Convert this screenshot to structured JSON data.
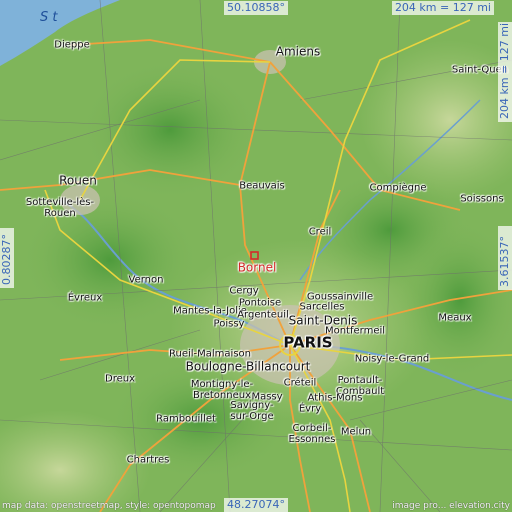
{
  "map": {
    "top_coordinate": "50.10858°",
    "bottom_coordinate": "48.27074°",
    "left_coordinate": "0.80287°",
    "right_coordinate": "3.61537°",
    "scale_horizontal": "204 km = 127 mi",
    "scale_vertical": "204 km = 127 mi",
    "sea_label": "S t",
    "credit_left": "map data: openstreetmap, style: opentopomap",
    "credit_right": "image pro... elevation.city"
  },
  "places": {
    "dieppe": "Dieppe",
    "amiens": "Amiens",
    "saint_quentin": "Saint-Quen",
    "rouen": "Rouen",
    "sotteville": "Sotteville-lès-Rouen",
    "beauvais": "Beauvais",
    "compiegne": "Compiègne",
    "soissons": "Soissons",
    "creil": "Creil",
    "bornel": "Bornel",
    "vernon": "Vernon",
    "evreux": "Évreux",
    "cergy": "Cergy",
    "pontoise": "Pontoise",
    "goussainville": "Goussainville",
    "sarcelles": "Sarcelles",
    "mantes": "Mantes-la-Jolie",
    "argenteuil": "Argenteuil",
    "saint_denis": "Saint-Denis",
    "poissy": "Poissy",
    "montfermeil": "Montfermeil",
    "meaux": "Meaux",
    "paris": "PARIS",
    "rueil": "Rueil-Malmaison",
    "noisy": "Noisy-le-Grand",
    "boulogne": "Boulogne-Billancourt",
    "dreux": "Dreux",
    "creteil": "Créteil",
    "pontault": "Pontault-Combault",
    "montigny": "Montigny-le-Bretonneux",
    "massy": "Massy",
    "athis": "Athis-Mons",
    "savigny": "Savigny-sur-Orge",
    "evry": "Évry",
    "rambouillet": "Rambouillet",
    "corbeil": "Corbeil-Essonnes",
    "melun": "Melun",
    "chartres": "Chartres"
  },
  "colors": {
    "land": "#7fb55a",
    "sea": "#7fb2d9",
    "road_major": "#f0a23c",
    "road_motorway": "#e8d440",
    "urban": "#c8c2b0",
    "highlight": "#d42a2a",
    "coord_text": "#3a66b8"
  }
}
